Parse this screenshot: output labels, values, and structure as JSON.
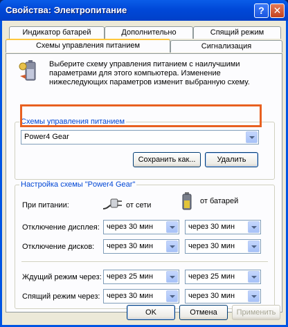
{
  "window": {
    "title": "Свойства: Электропитание"
  },
  "tabs_row1": [
    "Индикатор батарей",
    "Дополнительно",
    "Спящий режим"
  ],
  "tabs_row2": [
    "Схемы управления питанием",
    "Сигнализация"
  ],
  "description": "Выберите схему управления питанием с наилучшими параметрами для этого компьютера. Изменение нижеследующих параметров изменит выбранную схему.",
  "schemes": {
    "group_label": "Схемы управления питанием",
    "selected": "Power4 Gear",
    "save_label": "Сохранить как...",
    "delete_label": "Удалить"
  },
  "settings": {
    "group_label": "Настройка схемы \"Power4 Gear\"",
    "when_label": "При питании:",
    "ac_label": "от сети",
    "battery_label": "от батарей",
    "rows": [
      {
        "label": "Отключение дисплея:",
        "ac": "через 30 мин",
        "dc": "через 30 мин"
      },
      {
        "label": "Отключение дисков:",
        "ac": "через 30 мин",
        "dc": "через 30 мин"
      },
      {
        "label": "Ждущий режим через:",
        "ac": "через 25 мин",
        "dc": "через 25 мин"
      },
      {
        "label": "Спящий режим через:",
        "ac": "через 30 мин",
        "dc": "через 30 мин"
      }
    ]
  },
  "buttons": {
    "ok": "OK",
    "cancel": "Отмена",
    "apply": "Применить"
  }
}
